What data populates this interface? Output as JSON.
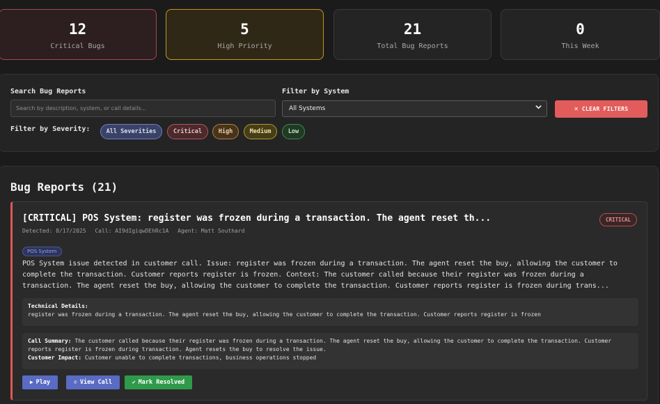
{
  "stats": [
    {
      "value": "12",
      "label": "Critical Bugs"
    },
    {
      "value": "5",
      "label": "High Priority"
    },
    {
      "value": "21",
      "label": "Total Bug Reports"
    },
    {
      "value": "0",
      "label": "This Week"
    }
  ],
  "filters": {
    "search_label": "Search Bug Reports",
    "search_placeholder": "Search by description, system, or call details...",
    "system_label": "Filter by System",
    "system_selected": "All Systems",
    "clear_label": "CLEAR FILTERS",
    "severity_label": "Filter by Severity:",
    "severities": [
      "All Severities",
      "Critical",
      "High",
      "Medium",
      "Low"
    ]
  },
  "reports": {
    "title": "Bug Reports (21)",
    "items": [
      {
        "title": "[CRITICAL] POS System: register was frozen during a transaction. The agent reset th...",
        "severity": "CRITICAL",
        "detected": "Detected: 8/17/2025",
        "call": "Call: AI9dIgiqwDEhRc1A",
        "agent": "Agent: Matt Southard",
        "system": "POS System",
        "description": "POS System issue detected in customer call. Issue: register was frozen during a transaction. The agent reset the buy, allowing the customer to complete the transaction. Customer reports register is frozen. Context: The customer called because their register was frozen during a transaction. The agent reset the buy, allowing the customer to complete the transaction. Customer reports register is frozen during trans...",
        "tech_label": "Technical Details:",
        "tech_text": "register was frozen during a transaction. The agent reset the buy, allowing the customer to complete the transaction. Customer reports register is frozen",
        "summary_label": "Call Summary:",
        "summary_text": "The customer called because their register was frozen during a transaction. The agent reset the buy, allowing the customer to complete the transaction. Customer reports register is frozen during transaction. Agent resets the buy to resolve the issue.",
        "impact_label": "Customer Impact:",
        "impact_text": "Customer unable to complete transactions, business operations stopped",
        "actions": {
          "play": "Play",
          "view_call": "View Call",
          "resolve": "Mark Resolved"
        }
      }
    ]
  },
  "colors": {
    "critical": "#e25c5c",
    "high": "#c49a1d",
    "accent": "#5a6bc4",
    "success": "#2f9a4a"
  },
  "icons": {
    "clear": "close-icon",
    "select": "chevron-down-icon",
    "play": "play-icon",
    "call": "phone-icon",
    "resolve": "check-circle-icon"
  }
}
